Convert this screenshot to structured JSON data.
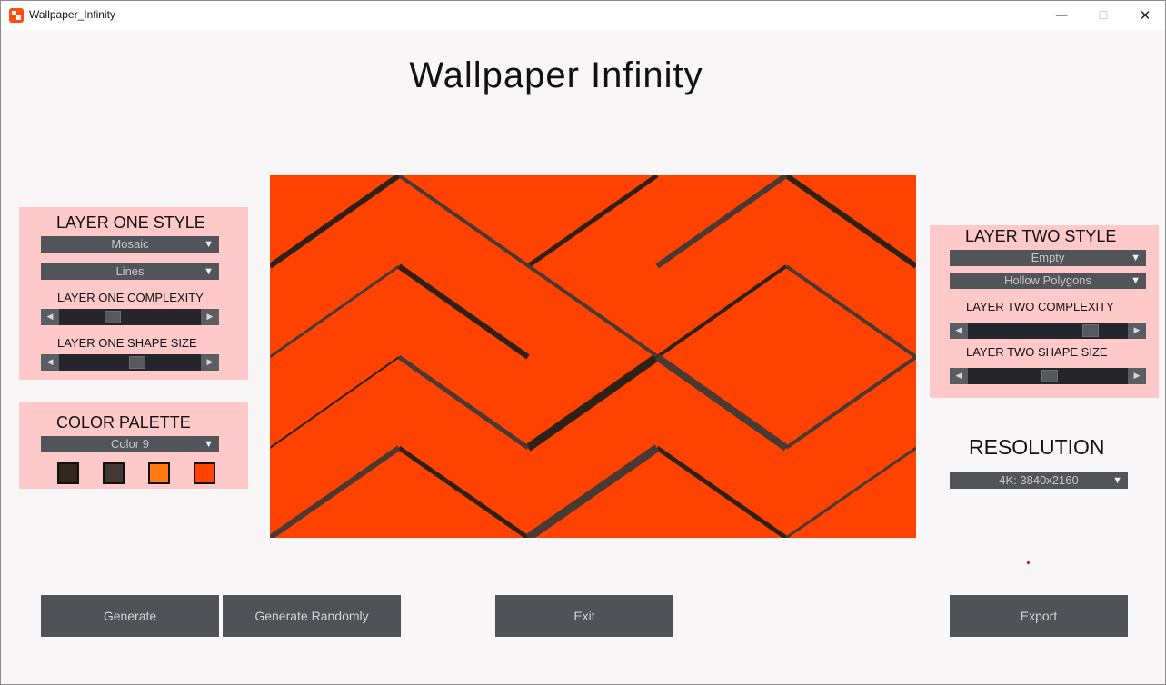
{
  "window": {
    "title": "Wallpaper_Infinity",
    "minimize": "—",
    "maximize": "☐",
    "close": "✕"
  },
  "app_title": "Wallpaper  Infinity",
  "layer_one": {
    "title": "LAYER ONE STYLE",
    "style_value": "Mosaic",
    "shape_value": "Lines",
    "complexity_label": "LAYER ONE COMPLEXITY",
    "complexity_level": 0.36,
    "shape_size_label": "LAYER ONE SHAPE SIZE",
    "shape_size_level": 0.56
  },
  "color_palette": {
    "title": "COLOR PALETTE",
    "value": "Color  9",
    "swatches": [
      "#33271d",
      "#433933",
      "#ff7b12",
      "#ff4200"
    ]
  },
  "layer_two": {
    "title": "LAYER TWO STYLE",
    "style_value": "Empty",
    "shape_value": "Hollow Polygons",
    "complexity_label": "LAYER TWO COMPLEXITY",
    "complexity_level": 0.8,
    "shape_size_label": "LAYER TWO SHAPE SIZE",
    "shape_size_level": 0.51
  },
  "resolution": {
    "title": "RESOLUTION",
    "value": "4K: 3840x2160"
  },
  "buttons": {
    "generate": "Generate",
    "generate_randomly": "Generate Randomly",
    "exit": "Exit",
    "export": "Export"
  },
  "preview": {
    "background": "#ff4200",
    "dark": "#2e2118",
    "mid": "#483a33"
  },
  "icons": {
    "dropdown": "▼",
    "left": "◀",
    "right": "▶"
  }
}
